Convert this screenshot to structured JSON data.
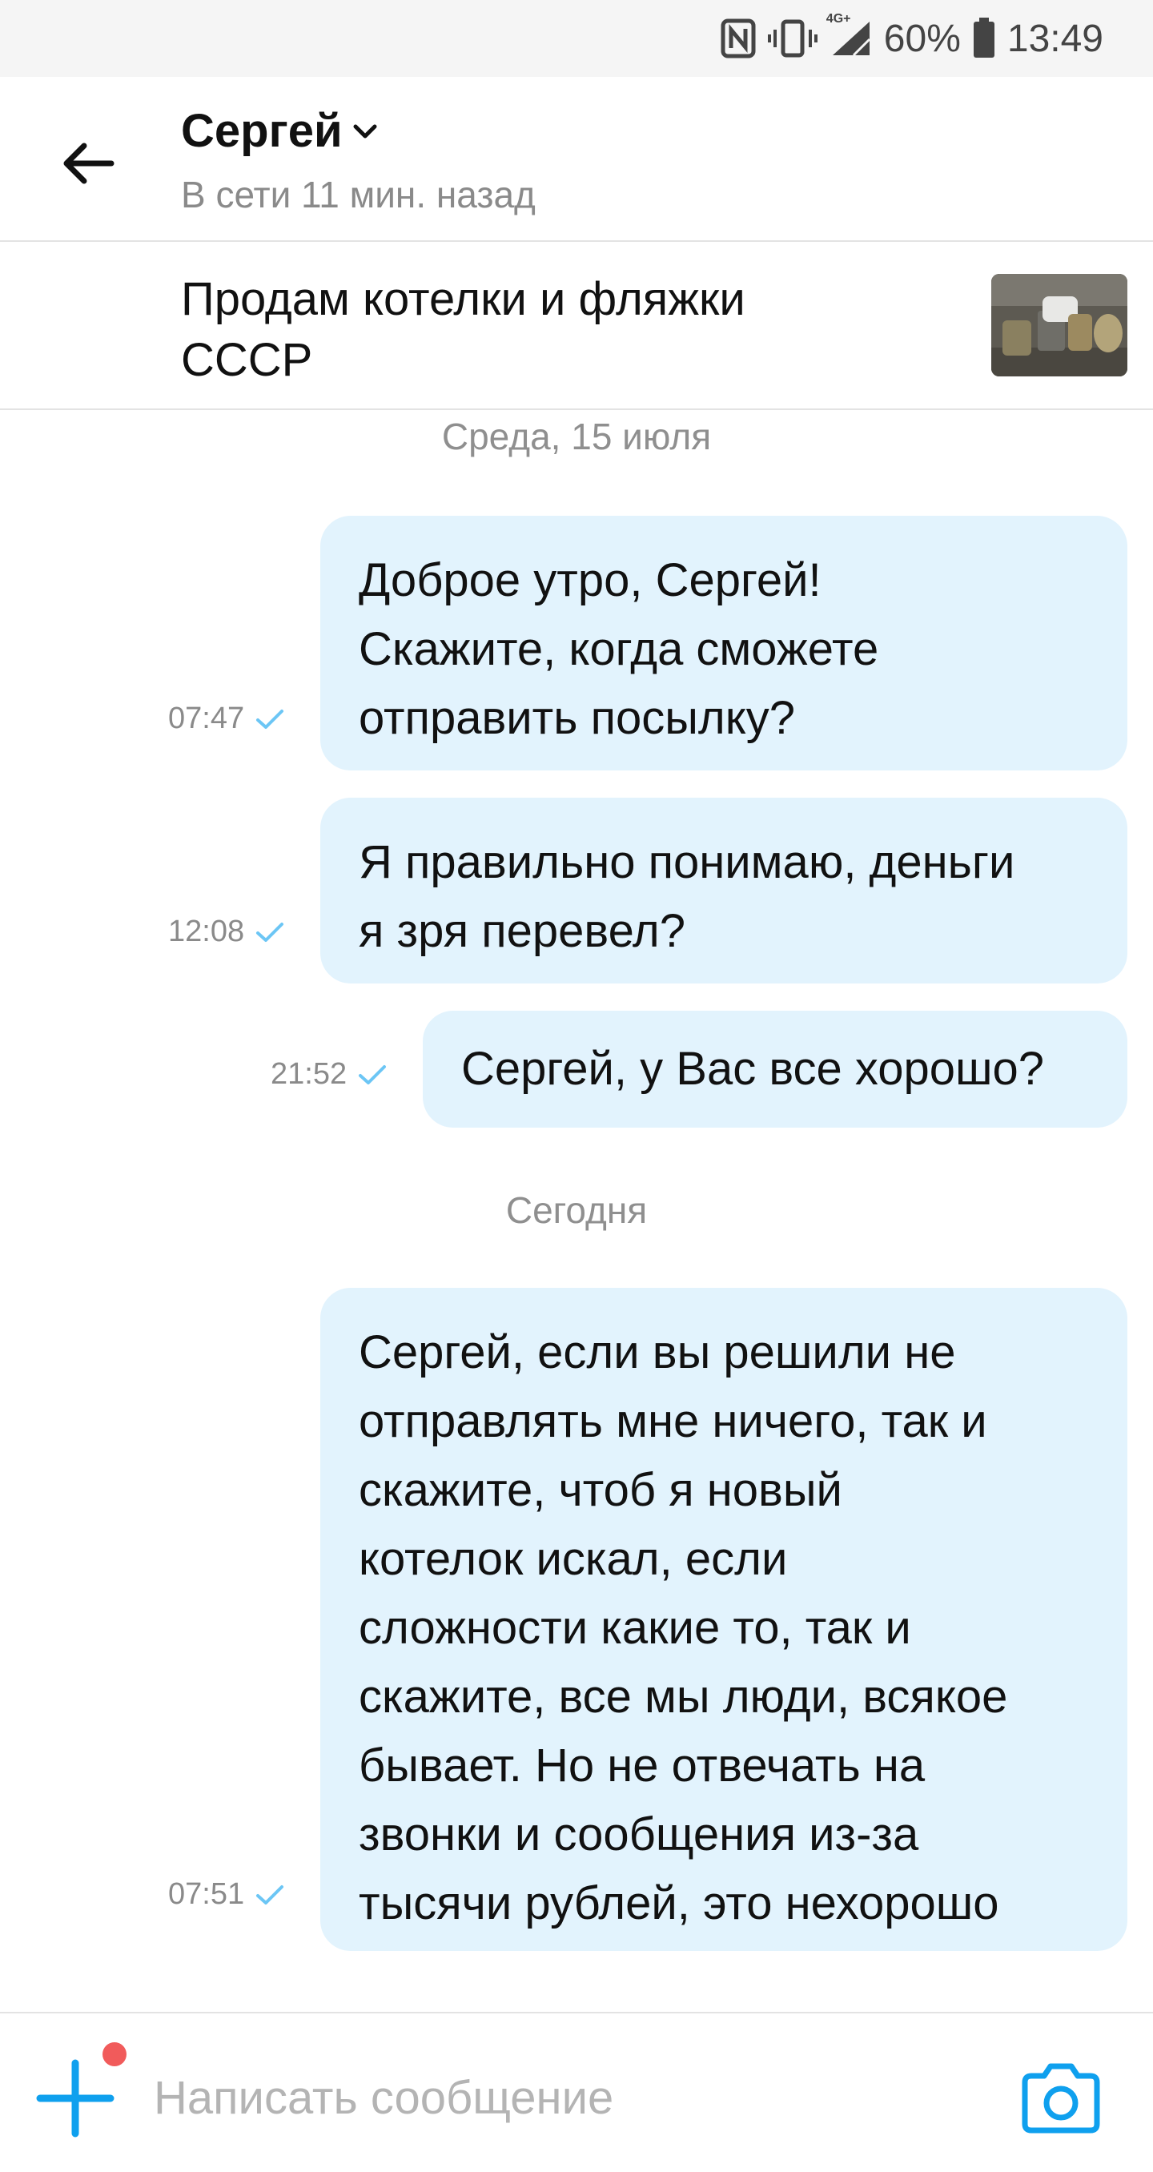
{
  "status_bar": {
    "network": "4G+",
    "battery": "60%",
    "time": "13:49"
  },
  "header": {
    "contact_name": "Сергей",
    "contact_status": "В сети 11 мин. назад"
  },
  "listing": {
    "title_lines": [
      "Продам котелки и фляжки",
      "СССР"
    ]
  },
  "days": [
    {
      "label": "Среда, 15 июля"
    },
    {
      "label": "Сегодня"
    }
  ],
  "messages": [
    {
      "time": "07:47",
      "lines": [
        "Доброе утро, Сергей!",
        "Скажите, когда сможете",
        "отправить посылку?"
      ]
    },
    {
      "time": "12:08",
      "lines": [
        "Я правильно понимаю, деньги",
        "я зря перевел?"
      ]
    },
    {
      "time": "21:52",
      "lines": [
        "Сергей, у Вас все хорошо?"
      ]
    },
    {
      "time": "07:51",
      "lines": [
        "Сергей, если вы решили не",
        "отправлять мне ничего, так и",
        "скажите, чтоб я новый",
        "котелок искал, если",
        "сложности какие то, так и",
        "скажите, все мы люди, всякое",
        "бывает. Но не отвечать на",
        "звонки и сообщения из-за",
        "тысячи рублей, это нехорошо"
      ]
    }
  ],
  "composer": {
    "placeholder": "Написать сообщение"
  },
  "colors": {
    "accent": "#0fa0ee",
    "bubble": "#e2f3fd",
    "check": "#6cc6f5",
    "badge": "#f15b5b"
  }
}
